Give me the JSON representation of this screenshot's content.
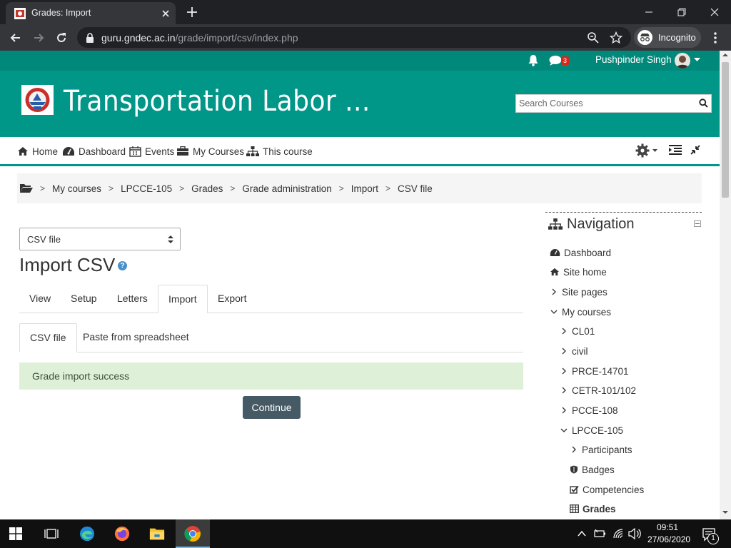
{
  "browser": {
    "tab_title": "Grades: Import",
    "url_host": "guru.gndec.ac.in",
    "url_path": "/grade/import/csv/index.php",
    "profile_label": "Incognito"
  },
  "usernav": {
    "message_count": "3",
    "user_name": "Pushpinder Singh"
  },
  "banner": {
    "site_title": "Transportation Labor ...",
    "search_placeholder": "Search Courses"
  },
  "menu": {
    "home": "Home",
    "dashboard": "Dashboard",
    "events": "Events",
    "my_courses": "My Courses",
    "this_course": "This course"
  },
  "breadcrumb": [
    "My courses",
    "LPCCE-105",
    "Grades",
    "Grade administration",
    "Import",
    "CSV file"
  ],
  "report_select": {
    "value": "CSV file"
  },
  "page_heading": "Import CSV",
  "tabs": [
    {
      "label": "View"
    },
    {
      "label": "Setup"
    },
    {
      "label": "Letters"
    },
    {
      "label": "Import",
      "active": true
    },
    {
      "label": "Export"
    }
  ],
  "subtabs": [
    {
      "label": "CSV file",
      "active": true
    },
    {
      "label": "Paste from spreadsheet"
    }
  ],
  "alert": "Grade import success",
  "continue_label": "Continue",
  "navigation": {
    "title": "Navigation",
    "items": [
      {
        "label": "Dashboard",
        "icon": "dashboard-icon"
      },
      {
        "label": "Site home",
        "icon": "home-icon"
      },
      {
        "label": "Site pages",
        "icon": "chevron-right-icon"
      },
      {
        "label": "My courses",
        "icon": "chevron-down-icon"
      },
      {
        "label": "CL01",
        "icon": "chevron-right-icon"
      },
      {
        "label": "civil",
        "icon": "chevron-right-icon"
      },
      {
        "label": "PRCE-14701",
        "icon": "chevron-right-icon"
      },
      {
        "label": "CETR-101/102",
        "icon": "chevron-right-icon"
      },
      {
        "label": "PCCE-108",
        "icon": "chevron-right-icon"
      },
      {
        "label": "LPCCE-105",
        "icon": "chevron-down-icon"
      },
      {
        "label": "Participants",
        "icon": "chevron-right-icon"
      },
      {
        "label": "Badges",
        "icon": "shield-icon"
      },
      {
        "label": "Competencies",
        "icon": "checkbox-icon"
      },
      {
        "label": "Grades",
        "icon": "table-icon"
      }
    ]
  },
  "taskbar": {
    "time": "09:51",
    "date": "27/06/2020",
    "notification_count": "1"
  },
  "colors": {
    "brand": "#009688",
    "usernav": "#00897b",
    "alert_bg": "#dff0d8",
    "button": "#455a64"
  }
}
